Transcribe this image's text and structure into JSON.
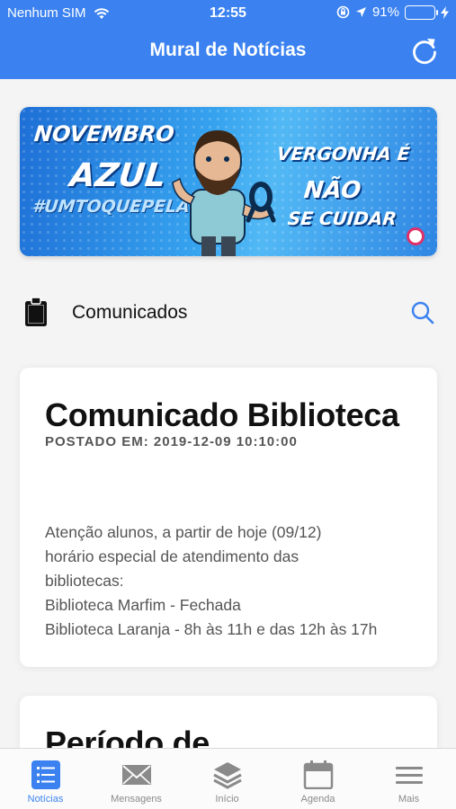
{
  "status_bar": {
    "carrier": "Nenhum SIM",
    "time": "12:55",
    "battery_percent": "91%",
    "battery_level": 0.91,
    "icons": [
      "wifi-icon",
      "orientation-lock-icon",
      "location-icon",
      "battery-icon",
      "charging-icon"
    ]
  },
  "header": {
    "title": "Mural de Notícias",
    "refresh_icon": "refresh-icon"
  },
  "banner": {
    "line1": "NOVEMBRO",
    "line2": "AZUL",
    "hashtag": "#UMTOQUEPELAVIDA",
    "slogan_1": "VERGONHA É",
    "slogan_2": "NÃO",
    "slogan_3": "SE CUIDAR"
  },
  "section": {
    "icon": "clipboard-icon",
    "title": "Comunicados",
    "search_icon": "search-icon"
  },
  "posts": [
    {
      "title": "Comunicado Biblioteca",
      "meta": "POSTADO EM: 2019-12-09 10:10:00",
      "body": [
        "Atenção alunos, a partir de hoje (09/12)",
        "horário especial de atendimento das",
        "bibliotecas:",
        "Biblioteca Marfim - Fechada",
        "Biblioteca Laranja - 8h às 11h e das 12h às 17h"
      ]
    },
    {
      "title": "Período de"
    }
  ],
  "tabs": [
    {
      "label": "Notícias",
      "icon": "news-list-icon",
      "active": true
    },
    {
      "label": "Mensagens",
      "icon": "envelope-icon",
      "active": false
    },
    {
      "label": "Início",
      "icon": "layers-icon",
      "active": false
    },
    {
      "label": "Agenda",
      "icon": "calendar-icon",
      "active": false
    },
    {
      "label": "Mais",
      "icon": "menu-icon",
      "active": false
    }
  ],
  "colors": {
    "accent": "#3b82f0",
    "battery": "#5ad45a",
    "tab_inactive": "#8a8a8a"
  }
}
